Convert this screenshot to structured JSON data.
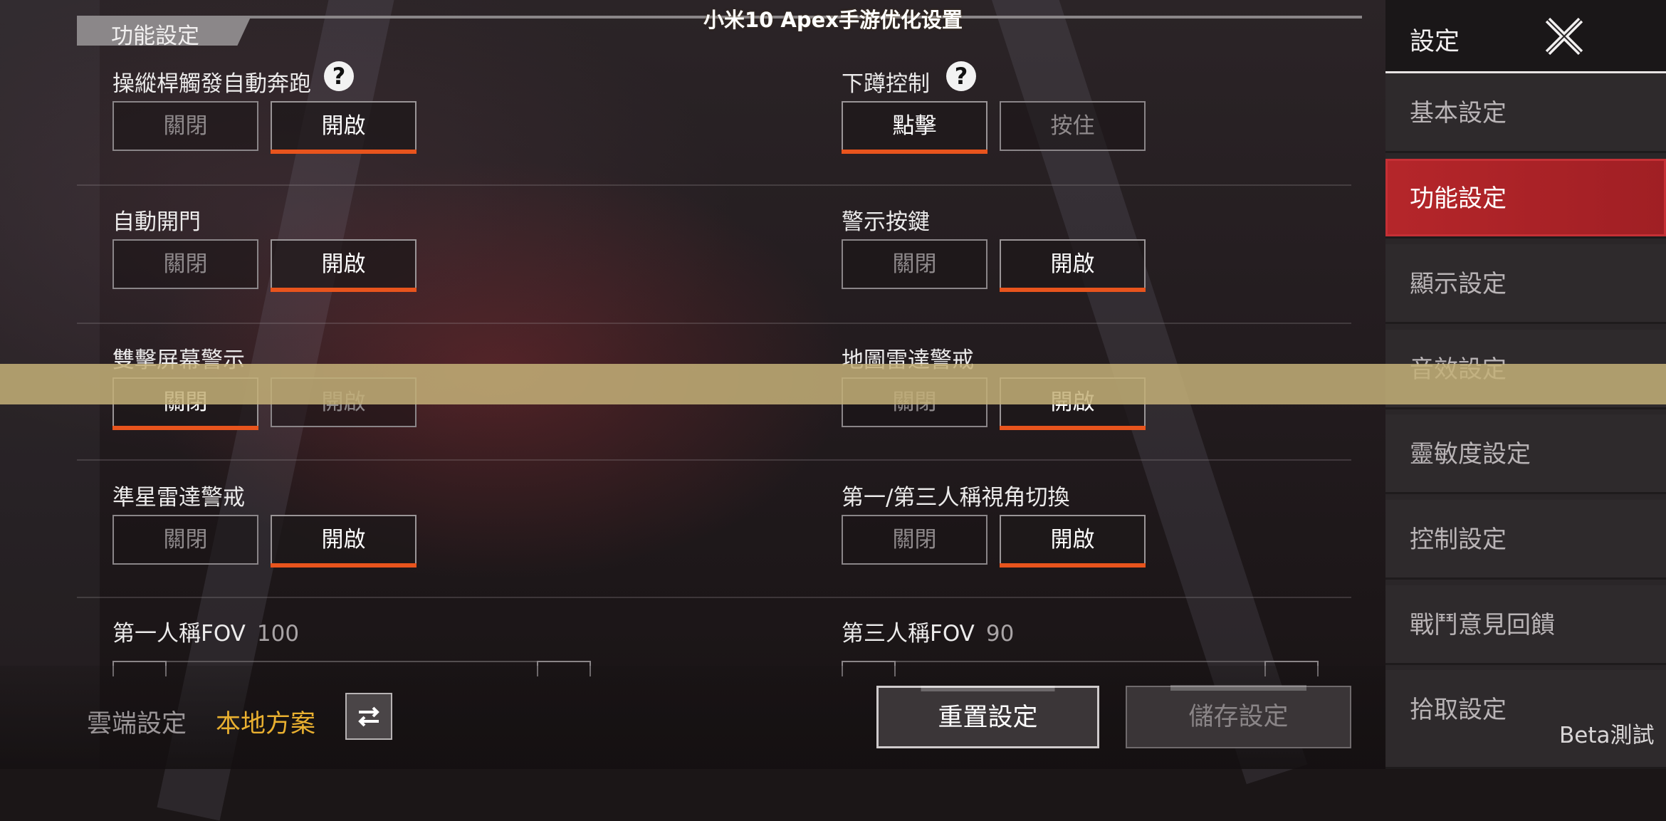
{
  "section": {
    "title": "功能設定"
  },
  "settings": {
    "auto_sprint": {
      "label": "操縱桿觸發自動奔跑",
      "off": "關閉",
      "on": "開啟"
    },
    "crouch": {
      "label": "下蹲控制",
      "opt1": "點擊",
      "opt2": "按住"
    },
    "auto_door": {
      "label": "自動開門",
      "off": "關閉",
      "on": "開啟"
    },
    "warning_key": {
      "label": "警示按鍵",
      "off": "關閉",
      "on": "開啟"
    },
    "double_screen_warning": {
      "label": "雙擊屏幕警示",
      "off": "關閉",
      "on": "開啟"
    },
    "map_radar": {
      "label": "地圖雷達警戒",
      "off": "關閉",
      "on": "開啟"
    },
    "crosshair_radar": {
      "label": "準星雷達警戒",
      "off": "關閉",
      "on": "開啟"
    },
    "view_switch": {
      "label": "第一/第三人稱視角切換",
      "off": "關閉",
      "on": "開啟"
    }
  },
  "fov": {
    "first_person": {
      "label": "第一人稱FOV",
      "value": "100"
    },
    "third_person": {
      "label": "第三人稱FOV",
      "value": "90"
    }
  },
  "bottom": {
    "cloud": "雲端設定",
    "local": "本地方案",
    "swap_icon": "swap-arrows-icon",
    "reset": "重置設定",
    "save": "儲存設定"
  },
  "sidebar": {
    "title": "設定",
    "items": [
      {
        "label": "基本設定"
      },
      {
        "label": "功能設定"
      },
      {
        "label": "顯示設定"
      },
      {
        "label": "音效設定"
      },
      {
        "label": "靈敏度設定"
      },
      {
        "label": "控制設定"
      },
      {
        "label": "戰鬥意見回饋"
      },
      {
        "label": "拾取設定"
      }
    ],
    "beta": "Beta測試"
  },
  "banner": {
    "text": "小米10 Apex手游优化设置"
  },
  "colors": {
    "accent": "#e8541d",
    "active_tab": "#b5262a",
    "local_highlight": "#e9b030"
  }
}
